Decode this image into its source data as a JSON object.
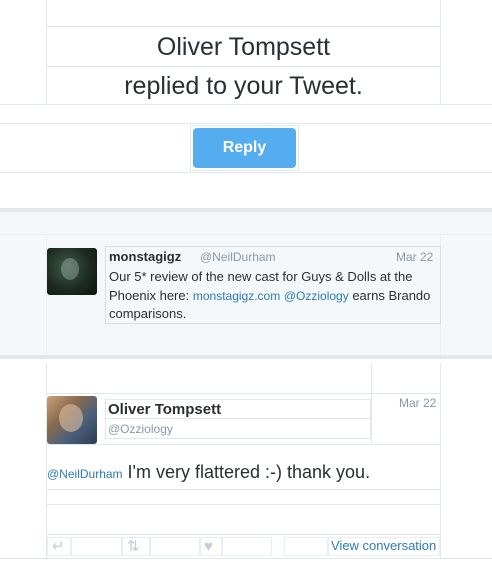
{
  "notification": {
    "line1": "Oliver Tompsett",
    "line2": "replied to your Tweet.",
    "reply_button": "Reply"
  },
  "quoted_tweet": {
    "name": "monstagigz",
    "handle": "@NeilDurham",
    "date": "Mar 22",
    "text_part1": "Our 5* review of the new cast for Guys & Dolls at the Phoenix here: ",
    "link1": "monstagigz.com",
    "link2": "@Ozziology",
    "text_part2": " earns Brando comparisons."
  },
  "reply_tweet": {
    "name": "Oliver Tompsett",
    "handle": "@Ozziology",
    "date": "Mar 22",
    "mention": "@NeilDurham",
    "text": " I'm very flattered :-) thank you.",
    "actions": {
      "reply_icon": "reply-icon",
      "retweet_icon": "retweet-icon",
      "favorite_icon": "heart-icon",
      "view_conversation": "View conversation"
    }
  }
}
